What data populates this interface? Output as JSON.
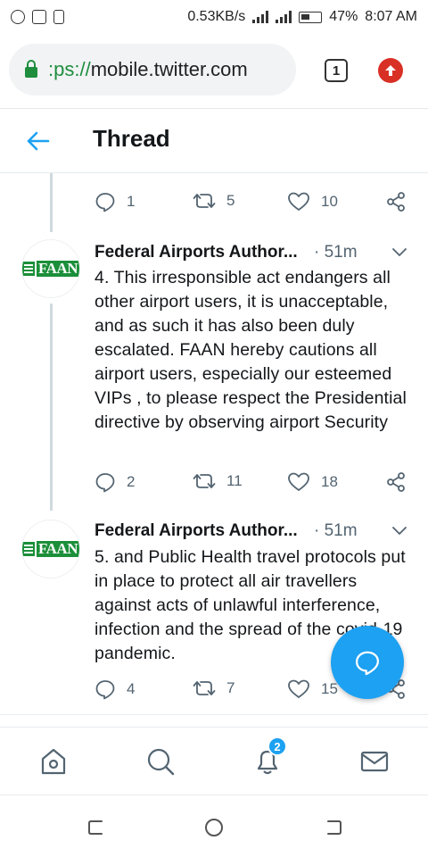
{
  "status_bar": {
    "network_speed": "0.53KB/s",
    "battery": "47%",
    "time": "8:07 AM",
    "left_icons": [
      "whatsapp-icon",
      "screenshot-icon",
      "battery-saver-icon"
    ]
  },
  "browser": {
    "url_scheme": ":ps://",
    "url_host": "mobile.twitter.com",
    "tab_count": "1"
  },
  "header": {
    "title": "Thread"
  },
  "partial_tweet": {
    "replies": "1",
    "retweets": "5",
    "likes": "10"
  },
  "tweets": [
    {
      "author": "Federal Airports Author...",
      "time": "· 51m",
      "avatar_text": "FAAN",
      "text": "4. This irresponsible act endangers all other airport users, it is unacceptable, and as such it has also been duly escalated. FAAN hereby cautions all airport users, especially our esteemed VIPs , to please respect the Presidential directive by observing  airport Security",
      "replies": "2",
      "retweets": "11",
      "likes": "18"
    },
    {
      "author": "Federal Airports Author...",
      "time": "· 51m",
      "avatar_text": "FAAN",
      "text": "5. and Public Health travel protocols put in place to protect all air travellers against acts of unlawful interference, infection and the spread of the covid-19 pandemic.",
      "replies": "4",
      "retweets": "7",
      "likes": "15"
    }
  ],
  "bottom_nav": {
    "notification_count": "2",
    "items": [
      "home-icon",
      "search-icon",
      "notifications-icon",
      "messages-icon"
    ]
  },
  "colors": {
    "accent": "#1da1f2",
    "lock": "#1e8e3e",
    "faan_green": "#1c8f3a",
    "update": "#d93025"
  }
}
